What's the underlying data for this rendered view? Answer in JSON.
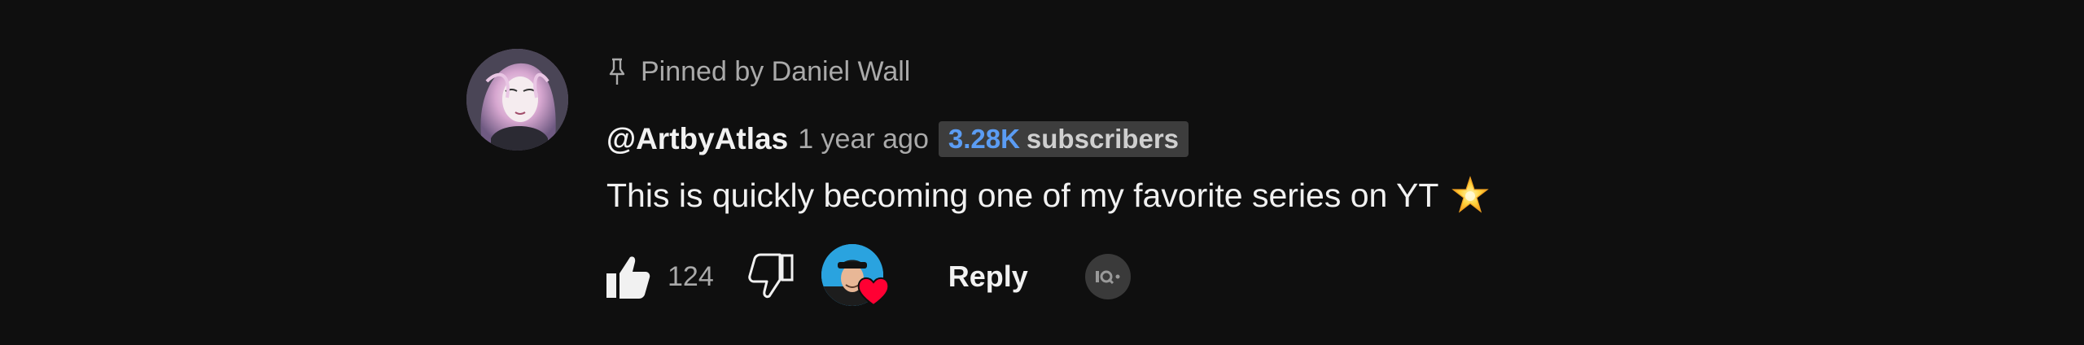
{
  "comment": {
    "pinned_text": "Pinned by Daniel Wall",
    "author": "@ArtbyAtlas",
    "timestamp": "1 year ago",
    "subscriber_count": "3.28K",
    "subscriber_word": "subscribers",
    "text": "This is quickly becoming one of my favorite series on YT",
    "emoji_icon": "star-emoji-icon",
    "like_count": "124",
    "reply_label": "Reply"
  },
  "colors": {
    "background": "#0f0f0f",
    "primary_text": "#f1f1f1",
    "secondary_text": "#aaaaaa",
    "subscriber_accent": "#5b9cf3",
    "heart": "#ff0033"
  },
  "icons": {
    "pin": "pin-icon",
    "like": "thumbs-up-icon",
    "dislike": "thumbs-down-icon",
    "creator_heart": "heart-icon",
    "extra": "extension-icon"
  }
}
